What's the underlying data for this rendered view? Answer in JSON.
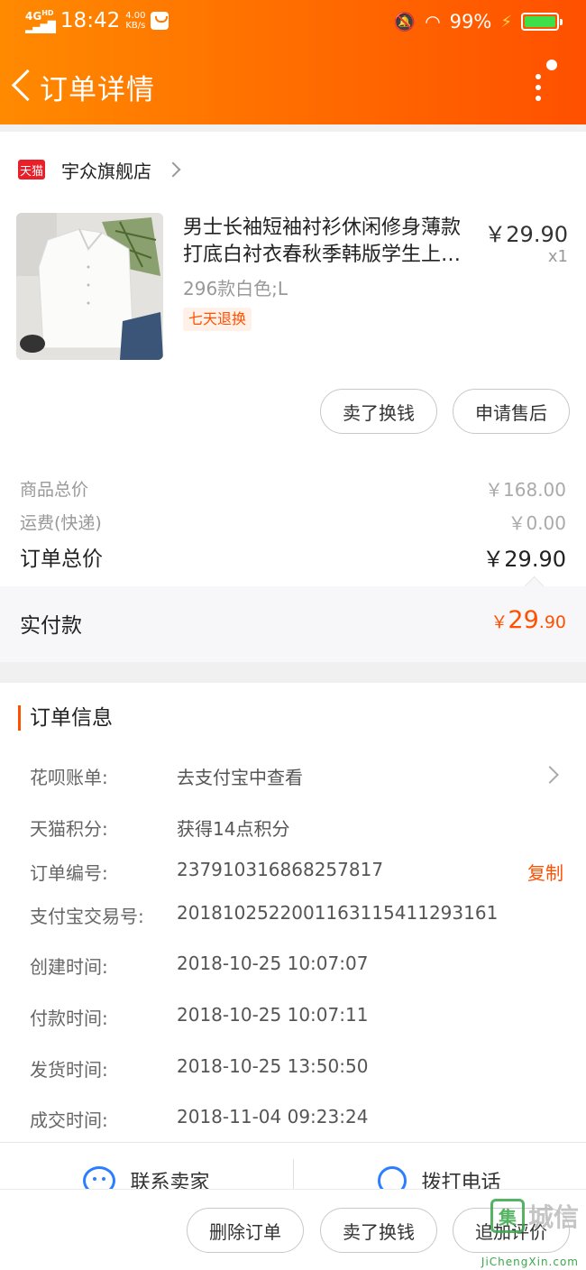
{
  "status_bar": {
    "network": "4G",
    "network_sup": "HD",
    "time": "18:42",
    "speed_value": "4.00",
    "speed_unit": "KB/s",
    "battery": "99%"
  },
  "nav": {
    "title": "订单详情"
  },
  "shop": {
    "badge": "天猫",
    "name": "宇众旗舰店"
  },
  "product": {
    "title_line1": "男士长袖短袖衬衫休闲修身薄款",
    "title_line2": "打底白衬衣春秋季韩版学生上…",
    "price": "￥29.90",
    "quantity": "x1",
    "sku": "296款白色;L",
    "tag": "七天退换"
  },
  "item_actions": {
    "sell": "卖了换钱",
    "after_sale": "申请售后"
  },
  "summary": {
    "goods_total_label": "商品总价",
    "goods_total": "￥168.00",
    "shipping_label": "运费(快递)",
    "shipping": "￥0.00",
    "order_total_label": "订单总价",
    "order_total": "￥29.90",
    "paid_label": "实付款",
    "paid_currency": "￥",
    "paid_int": "29",
    "paid_dec": ".90"
  },
  "order_info": {
    "heading": "订单信息",
    "rows": [
      {
        "label": "花呗账单:",
        "value": "去支付宝中查看"
      },
      {
        "label": "天猫积分:",
        "value": "获得14点积分"
      },
      {
        "label": "订单编号:",
        "value": "237910316868257817",
        "action": "复制"
      },
      {
        "label": "支付宝交易号:",
        "value": "2018102522001163115411293161"
      },
      {
        "label": "创建时间:",
        "value": "2018-10-25 10:07:07"
      },
      {
        "label": "付款时间:",
        "value": "2018-10-25 10:07:11"
      },
      {
        "label": "发货时间:",
        "value": "2018-10-25 13:50:50"
      },
      {
        "label": "成交时间:",
        "value": "2018-11-04 09:23:24"
      }
    ]
  },
  "contact": {
    "seller": "联系卖家",
    "phone": "拨打电话"
  },
  "bottom_actions": {
    "delete": "删除订单",
    "sell": "卖了换钱",
    "review": "追加评价"
  },
  "watermark": {
    "logo": "集",
    "text": "城信",
    "url": "JiChengXin.com"
  },
  "colors": {
    "accent": "#ff5000",
    "header_start": "#ff8a00",
    "link_blue": "#2b7fff",
    "tmall_red": "#e8202a"
  }
}
